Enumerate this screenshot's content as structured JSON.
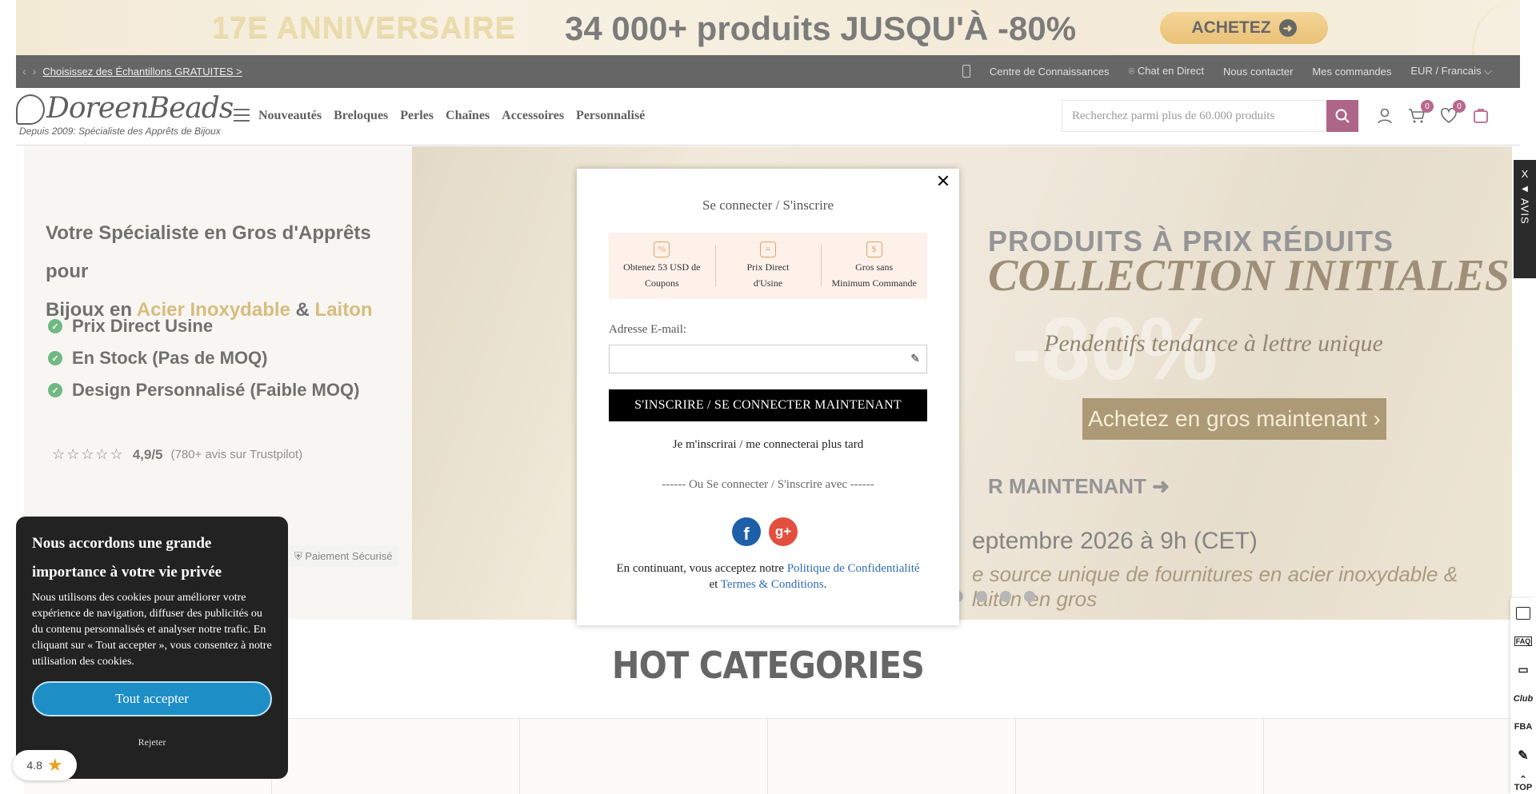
{
  "top_banner": {
    "left_text": "17E ANNIVERSAIRE",
    "main_text": "34 000+ produits JUSQU'À -80%",
    "button": "ACHETEZ",
    "button_arrow": "➜"
  },
  "utility_bar": {
    "samples_link": "Choisissez des Échantillons GRATUITES >",
    "prev": "‹",
    "next": "›",
    "links": [
      "Centre de Connaissances",
      "Chat en Direct",
      "Nous contacter",
      "Mes commandes"
    ],
    "currency_lang": "EUR / Francais ⌵"
  },
  "header": {
    "logo_name": "DoreenBeads",
    "logo_tagline": "Depuis 2009: Spécialiste des Apprêts de Bijoux",
    "nav": [
      "Nouveautés",
      "Breloques",
      "Perles",
      "Chaînes",
      "Accessoires",
      "Personnalisé"
    ],
    "search_placeholder": "Recherchez parmi plus de 60.000 produits",
    "cart_count": "0",
    "wishlist_count": "0",
    "accent_color": "#8e2b5b"
  },
  "hero": {
    "headline_1": "Votre Spécialiste en Gros d'Apprêts pour",
    "headline_2a": "Bijoux en ",
    "headline_gold1": "Acier Inoxydable",
    "headline_amp": " & ",
    "headline_gold2": "Laiton",
    "features": [
      "Prix Direct Usine",
      "En Stock (Pas de MOQ)",
      "Design Personnalisé (Faible MOQ)"
    ],
    "stars": "☆☆☆☆☆",
    "rating": "4,9/5",
    "reviews": "(780+ avis sur Trustpilot)",
    "payment": "Paiement Sécurisé",
    "banner_line1": "PRODUITS À PRIX RÉDUITS",
    "banner_line2": "COLLECTION INITIALES",
    "banner_pct": "-80%",
    "banner_line3": "Pendentifs tendance à lettre unique",
    "banner_cta": "Achetez en gros maintenant ›",
    "banner_cta2": "R MAINTENANT ➜",
    "banner_date": "eptembre 2026 à 9h (CET)",
    "banner_source": "e source unique de fournitures en acier inoxydable & laiton en gros"
  },
  "section_title": "HOT CATEGORIES",
  "modal": {
    "title": "Se connecter / S'inscrire",
    "close": "✕",
    "benefits": [
      {
        "icon": "%",
        "line1": "Obtenez 53 USD de",
        "line2": "Coupons"
      },
      {
        "icon": "≡",
        "line1": "Prix Direct",
        "line2": "d'Usine"
      },
      {
        "icon": "$",
        "line1": "Gros sans",
        "line2": "Minimum Commande"
      }
    ],
    "email_label": "Adresse E-mail:",
    "email_value": "",
    "submit": "S'INSCRIRE / SE CONNECTER MAINTENANT",
    "later": "Je m'inscrirai / me connecterai plus tard",
    "or_line": "------ Ou Se connecter / S'inscrire avec ------",
    "facebook": "f",
    "google": "g+",
    "terms_prefix": "En continuant, vous acceptez notre ",
    "privacy_link": "Politique de Confidentialité",
    "terms_and": "et ",
    "terms_link": "Termes & Conditions",
    "terms_suffix": "."
  },
  "cookie": {
    "title": "Nous accordons une grande importance à votre vie privée",
    "body": "Nous utilisons des cookies pour améliorer votre expérience de navigation, diffuser des publicités ou du contenu personnalisés et analyser notre trafic. En cliquant sur « Tout accepter », vous consentez à notre utilisation des cookies.",
    "accept": "Tout accepter",
    "reject": "Rejeter"
  },
  "rating_widget": {
    "value": "4.8",
    "star": "★"
  },
  "side_review": {
    "close": "X",
    "arrow": "◀",
    "label": "AVIS"
  },
  "side_tools": [
    "FAQ",
    "Club",
    "FBA",
    "TOP"
  ]
}
